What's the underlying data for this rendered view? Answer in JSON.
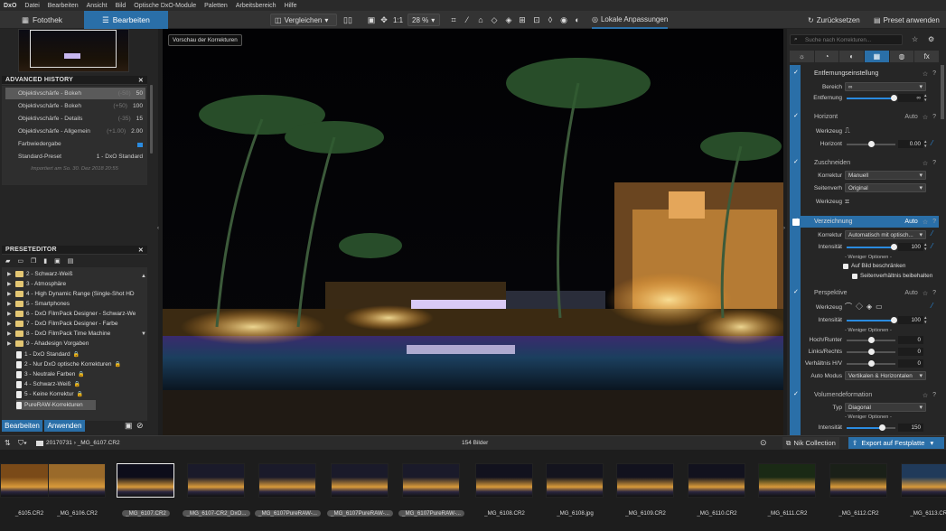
{
  "app": {
    "logo": "DxO"
  },
  "menu": [
    "Datei",
    "Bearbeiten",
    "Ansicht",
    "Bild",
    "Optische DxO-Module",
    "Paletten",
    "Arbeitsbereich",
    "Hilfe"
  ],
  "toolbar": {
    "tab_library": "Fotothek",
    "tab_edit": "Bearbeiten",
    "compare": "Vergleichen",
    "zoom_fit": "1:1",
    "zoom": "28 %",
    "local_adjustments": "Lokale Anpassungen",
    "reset": "Zurücksetzen",
    "preset_apply": "Preset anwenden"
  },
  "history": {
    "title": "ADVANCED HISTORY",
    "items": [
      {
        "label": "Objektivschärfe - Bokeh",
        "delta": "(-50)",
        "value": "50"
      },
      {
        "label": "Objektivschärfe - Bokeh",
        "delta": "(+50)",
        "value": "100"
      },
      {
        "label": "Objektivschärfe - Details",
        "delta": "(-35)",
        "value": "15"
      },
      {
        "label": "Objektivschärfe - Allgemein",
        "delta": "(+1.00)",
        "value": "2.00"
      },
      {
        "label": "Farbwiedergabe",
        "delta": "",
        "value": ""
      },
      {
        "label": "Standard-Preset",
        "delta": "",
        "value": "1 - DxO Standard"
      }
    ],
    "imported": "Importiert am So. 30. Dez 2018 20:55"
  },
  "preset_editor": {
    "title": "PRESETEDITOR",
    "folders": [
      "2 - Schwarz-Weiß",
      "3 - Atmosphäre",
      "4 - High Dynamic Range (Single-Shot HD",
      "5 - Smartphones",
      "6 - DxO FilmPack Designer - Schwarz-We",
      "7 - DxO FilmPack Designer - Farbe",
      "8 - DxO FilmPack Time Machine",
      "9 - Ahadesign Vorgaben"
    ],
    "presets": [
      "1 - DxO Standard",
      "2 - Nur DxO optische Korrekturen",
      "3 - Neutrale Farben",
      "4 - Schwarz-Weiß",
      "5 - Keine Korrektur",
      "PureRAW-Korrekturen"
    ],
    "btn_edit": "Bearbeiten",
    "btn_apply": "Anwenden"
  },
  "preview": {
    "button": "Vorschau der Korrekturen"
  },
  "right": {
    "search_placeholder": "Suche nach Korrekturen...",
    "tabs": [
      "☼",
      "◔",
      "◐",
      "▦",
      "◍",
      "fx"
    ],
    "distance": {
      "title": "Entfernungseinstellung",
      "range_label": "Bereich",
      "range_value": "∞",
      "dist_label": "Entfernung",
      "dist_value": "∞"
    },
    "horizon": {
      "title": "Horizont",
      "auto": "Auto",
      "tool_label": "Werkzeug",
      "horizon_label": "Horizont",
      "value": "0.00"
    },
    "crop": {
      "title": "Zuschneiden",
      "corr_label": "Korrektur",
      "corr_value": "Manuell",
      "ratio_label": "Seitenverh",
      "ratio_value": "Original",
      "tool_label": "Werkzeug"
    },
    "distortion": {
      "title": "Verzeichnung",
      "auto": "Auto",
      "corr_label": "Korrektur",
      "corr_value": "Automatisch mit optisch...",
      "int_label": "Intensität",
      "int_value": "100",
      "fewer": "- Weniger Optionen -",
      "opt1": "Auf Bild beschränken",
      "opt2": "Seitenverhältnis beibehalten"
    },
    "perspective": {
      "title": "Perspektive",
      "auto": "Auto",
      "tool_label": "Werkzeug",
      "int_label": "Intensität",
      "int_value": "100",
      "fewer": "- Weniger Optionen -",
      "hr_label": "Hoch/Runter",
      "hr_value": "0",
      "lr_label": "Links/Rechts",
      "lr_value": "0",
      "ratio_label": "Verhältnis H/V",
      "ratio_value": "0",
      "mode_label": "Auto Modus",
      "mode_value": "Vertikalen & Horizontalen"
    },
    "volume": {
      "title": "Volumendeformation",
      "type_label": "Typ",
      "type_value": "Diagonal",
      "fewer": "- Weniger Optionen -",
      "int_label": "Intensität",
      "int_value": "150"
    }
  },
  "filmbar": {
    "path": "20170731 › _MG_6107.CR2",
    "count": "154 Bilder",
    "nik": "Nik Collection",
    "export": "Export auf Festplatte"
  },
  "thumbs": [
    {
      "name": "_6105.CR2",
      "pill": false
    },
    {
      "name": "_MG_6106.CR2",
      "pill": false
    },
    {
      "name": "_MG_6107.CR2",
      "pill": true
    },
    {
      "name": "_MG_6107-CR2_DxO...",
      "pill": true
    },
    {
      "name": "_MG_6107PureRAW-...",
      "pill": true
    },
    {
      "name": "_MG_6107PureRAW-...",
      "pill": true
    },
    {
      "name": "_MG_6107PureRAW-...",
      "pill": true
    },
    {
      "name": "_MG_6108.CR2",
      "pill": false
    },
    {
      "name": "_MG_6108.jpg",
      "pill": false
    },
    {
      "name": "_MG_6109.CR2",
      "pill": false
    },
    {
      "name": "_MG_6110.CR2",
      "pill": false
    },
    {
      "name": "_MG_6111.CR2",
      "pill": false
    },
    {
      "name": "_MG_6112.CR2",
      "pill": false
    },
    {
      "name": "_MG_6113.CR2",
      "pill": false
    }
  ],
  "colors": {
    "accent": "#2a6fa8",
    "slider": "#2a8be0",
    "folder": "#e3c673"
  }
}
